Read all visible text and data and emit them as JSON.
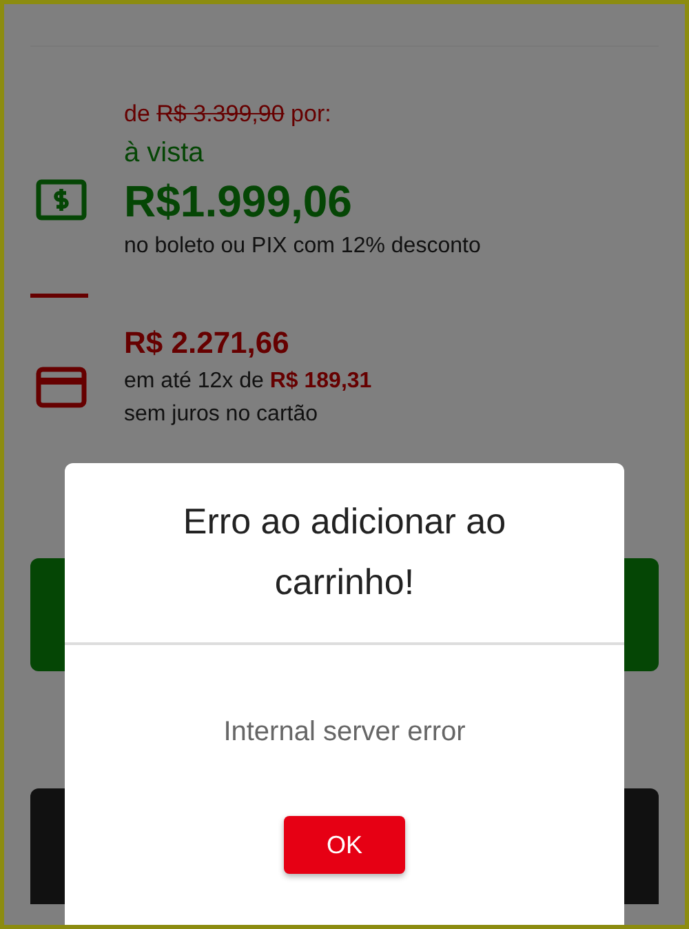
{
  "price_box": {
    "old_price_prefix": "de",
    "old_price": "R$ 3.399,90",
    "old_price_suffix": "por:",
    "cash_label": "à vista",
    "cash_price": "R$1.999,06",
    "cash_note": "no boleto ou PIX com 12% desconto",
    "card_price": "R$ 2.271,66",
    "installments": "em até 12x de **R$ 189,31**",
    "card_note": "sem juros no cartão"
  },
  "dialog": {
    "title": "Erro ao adicionar ao carrinho!",
    "message": "Internal server error",
    "button": "OK"
  }
}
